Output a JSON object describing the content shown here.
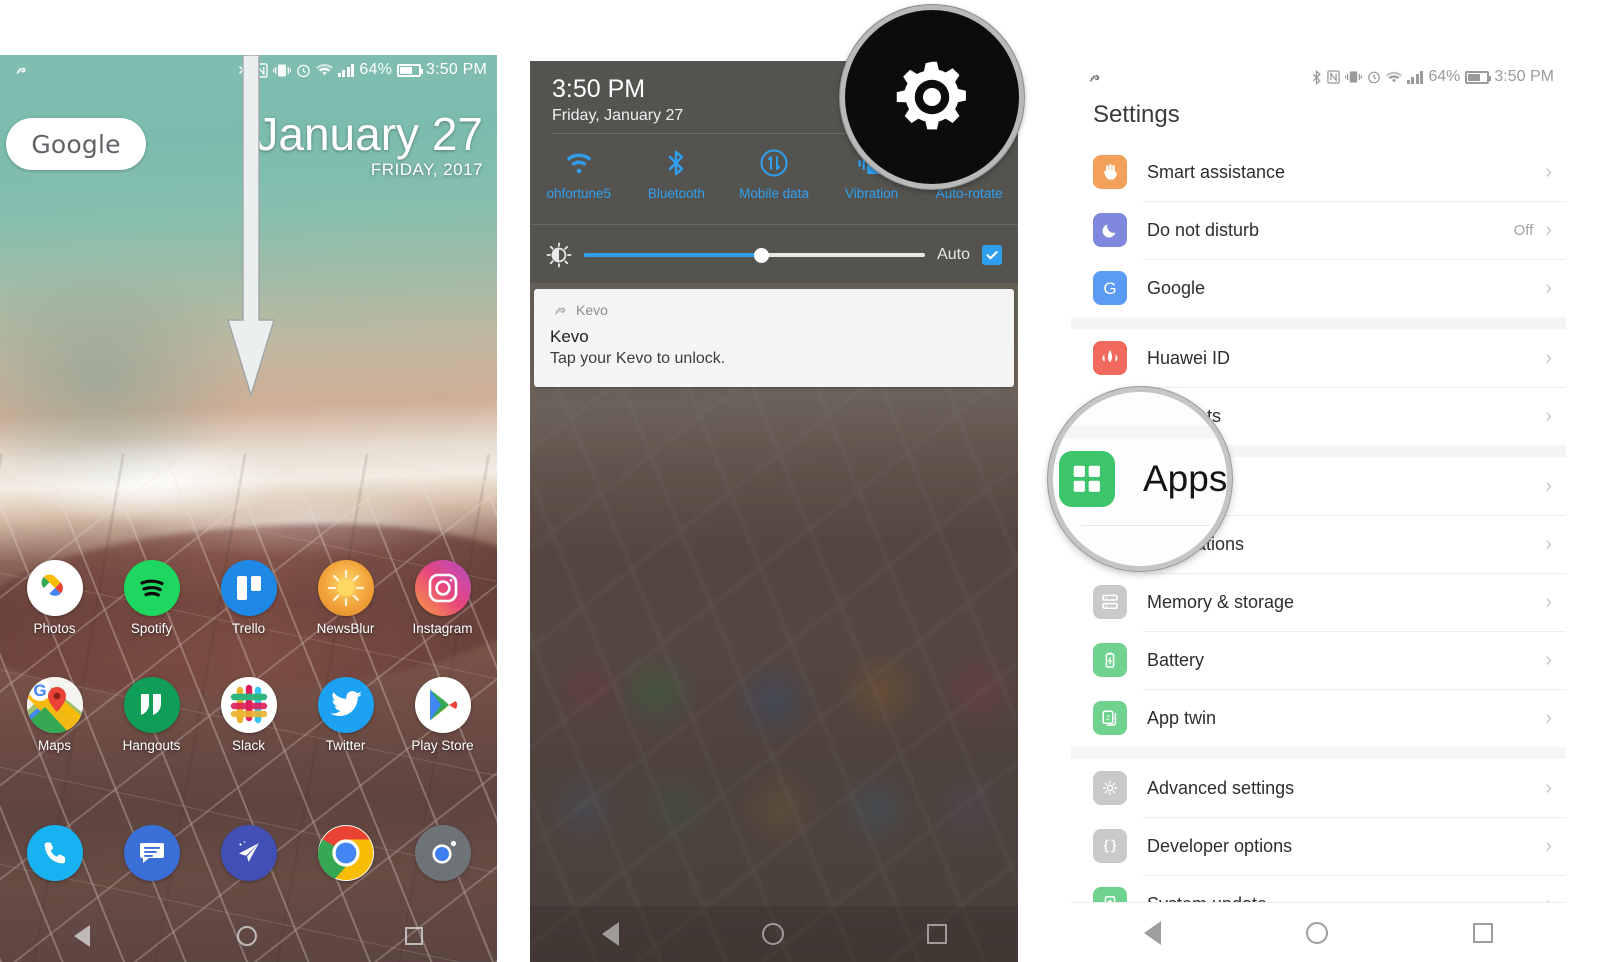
{
  "panel1": {
    "name": "home-screen",
    "status_bar": {
      "left_icon": "key-icon",
      "icons": [
        "bluetooth-icon",
        "nfc-icon",
        "vibrate-icon",
        "alarm-icon",
        "wifi-icon",
        "signal-icon"
      ],
      "battery_percent": "64%",
      "time": "3:50 PM"
    },
    "search_pill": "Google",
    "date_widget": {
      "day": "January 27",
      "sub": "FRIDAY, 2017"
    },
    "annotation": "down-arrow-swipe-gesture",
    "apps_row1": [
      {
        "label": "Photos",
        "icon": "google-photos-icon"
      },
      {
        "label": "Spotify",
        "icon": "spotify-icon"
      },
      {
        "label": "Trello",
        "icon": "trello-icon"
      },
      {
        "label": "NewsBlur",
        "icon": "newsblur-icon"
      },
      {
        "label": "Instagram",
        "icon": "instagram-icon"
      }
    ],
    "apps_row2": [
      {
        "label": "Maps",
        "icon": "google-maps-icon"
      },
      {
        "label": "Hangouts",
        "icon": "hangouts-icon"
      },
      {
        "label": "Slack",
        "icon": "slack-icon"
      },
      {
        "label": "Twitter",
        "icon": "twitter-icon"
      },
      {
        "label": "Play Store",
        "icon": "play-store-icon"
      }
    ],
    "dock": [
      {
        "label": "Phone",
        "icon": "phone-icon"
      },
      {
        "label": "Messages",
        "icon": "messages-icon"
      },
      {
        "label": "Inbox",
        "icon": "inbox-icon"
      },
      {
        "label": "Chrome",
        "icon": "chrome-icon"
      },
      {
        "label": "Camera",
        "icon": "camera-icon"
      }
    ],
    "nav": [
      "back-button",
      "home-button",
      "recents-button"
    ]
  },
  "panel2": {
    "name": "quick-settings-shade",
    "clock": {
      "time": "3:50 PM",
      "date": "Friday, January 27"
    },
    "tiles": [
      {
        "label": "ohfortune5",
        "icon": "wifi-icon"
      },
      {
        "label": "Bluetooth",
        "icon": "bluetooth-icon"
      },
      {
        "label": "Mobile data",
        "icon": "mobile-data-icon"
      },
      {
        "label": "Vibration",
        "icon": "vibration-icon"
      },
      {
        "label": "Auto-rotate",
        "icon": "auto-rotate-icon"
      }
    ],
    "brightness": {
      "icon": "brightness-icon",
      "value_percent": 52,
      "auto_label": "Auto",
      "auto_checked": true
    },
    "notification": {
      "app_icon": "key-icon",
      "app_name": "Kevo",
      "title": "Kevo",
      "body": "Tap your Kevo to unlock."
    },
    "callout": {
      "icon": "settings-gear-icon",
      "label": ""
    },
    "nav": [
      "back-button",
      "home-button",
      "recents-button"
    ]
  },
  "panel3": {
    "name": "settings-app",
    "status_bar": {
      "left_icon": "key-icon",
      "battery_percent": "64%",
      "time": "3:50 PM"
    },
    "title": "Settings",
    "items": [
      {
        "label": "Smart assistance",
        "value": "",
        "icon": "hand-icon",
        "icon_color": "#f2a05a"
      },
      {
        "label": "Do not disturb",
        "value": "Off",
        "icon": "moon-icon",
        "icon_color": "#8088dd"
      },
      {
        "label": "Google",
        "value": "",
        "icon": "google-g-icon",
        "icon_color": "#5b9af5"
      },
      {
        "label": "Huawei ID",
        "value": "",
        "icon": "huawei-icon",
        "icon_color": "#f2695e"
      },
      {
        "label": "Accounts",
        "value": "",
        "icon": "accounts-icon",
        "icon_color": "#f2695e"
      },
      {
        "label": "Apps",
        "value": "",
        "icon": "apps-grid-icon",
        "icon_color": "#3ec46b"
      },
      {
        "label": "Applications",
        "value": "",
        "icon": "applications-icon",
        "icon_color": "#3ec46b"
      },
      {
        "label": "Memory & storage",
        "value": "",
        "icon": "storage-icon",
        "icon_color": "#c9c9c9"
      },
      {
        "label": "Battery",
        "value": "",
        "icon": "battery-icon",
        "icon_color": "#6fd38f"
      },
      {
        "label": "App twin",
        "value": "",
        "icon": "app-twin-icon",
        "icon_color": "#6fd38f"
      },
      {
        "label": "Advanced settings",
        "value": "",
        "icon": "gear-icon",
        "icon_color": "#c9c9c9"
      },
      {
        "label": "Developer options",
        "value": "",
        "icon": "braces-icon",
        "icon_color": "#c9c9c9"
      },
      {
        "label": "System update",
        "value": "",
        "icon": "system-update-icon",
        "icon_color": "#6fd38f"
      }
    ],
    "callout": {
      "label": "Apps",
      "icon": "apps-grid-icon"
    },
    "nav": [
      "back-button",
      "home-button",
      "recents-button"
    ]
  }
}
